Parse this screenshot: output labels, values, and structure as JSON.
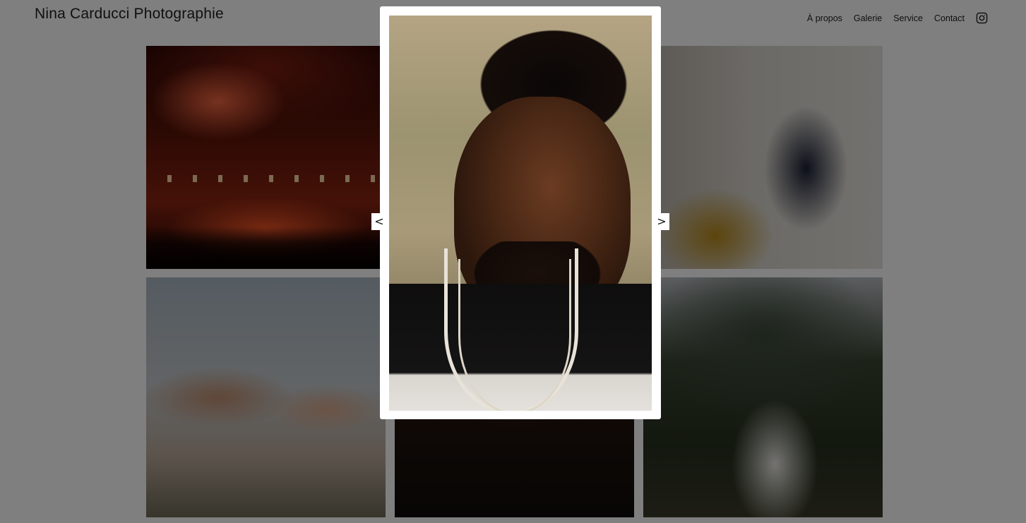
{
  "header": {
    "brand": "Nina Carducci Photographie",
    "nav": [
      {
        "label": "À propos"
      },
      {
        "label": "Galerie"
      },
      {
        "label": "Service"
      },
      {
        "label": "Contact"
      }
    ],
    "social_icon": "instagram-icon"
  },
  "gallery": {
    "tiles": [
      "concert",
      "woman-smiling",
      "hands",
      "portrait-man",
      "wedding-couple"
    ]
  },
  "lightbox": {
    "prev_label": "<",
    "next_label": ">"
  },
  "colors": {
    "overlay": "rgba(0,0,0,0.5)",
    "text": "#1f1f1f",
    "lightbox_bg": "#ffffff"
  }
}
